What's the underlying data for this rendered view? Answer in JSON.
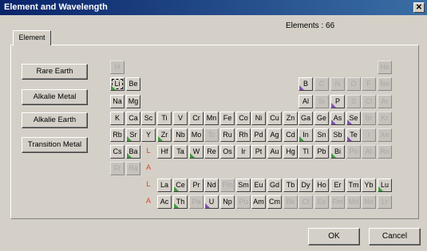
{
  "window": {
    "title": "Element and Wavelength",
    "close_glyph": "✕"
  },
  "count_label": "Elements : 66",
  "tab_label": "Element",
  "side_buttons": [
    "Rare Earth",
    "Alkalie Metal",
    "Alkalie Earth",
    "Transition Metal"
  ],
  "ok_label": "OK",
  "cancel_label": "Cancel",
  "colors": {
    "green_marker": "#3c9a3c",
    "purple_marker": "#8050b0",
    "row_marker": "#e0401a"
  },
  "cells": [
    {
      "r": 0,
      "c": 0,
      "s": "H",
      "st": "off"
    },
    {
      "r": 0,
      "c": 17,
      "s": "He",
      "st": "off"
    },
    {
      "r": 1,
      "c": 0,
      "s": "Li",
      "st": "on",
      "sel": true,
      "m": "g"
    },
    {
      "r": 1,
      "c": 1,
      "s": "Be",
      "st": "on"
    },
    {
      "r": 1,
      "c": 12,
      "s": "B",
      "st": "on",
      "m": "p"
    },
    {
      "r": 1,
      "c": 13,
      "s": "C",
      "st": "off"
    },
    {
      "r": 1,
      "c": 14,
      "s": "N",
      "st": "off"
    },
    {
      "r": 1,
      "c": 15,
      "s": "O",
      "st": "off"
    },
    {
      "r": 1,
      "c": 16,
      "s": "F",
      "st": "off"
    },
    {
      "r": 1,
      "c": 17,
      "s": "Ne",
      "st": "off"
    },
    {
      "r": 2,
      "c": 0,
      "s": "Na",
      "st": "on"
    },
    {
      "r": 2,
      "c": 1,
      "s": "Mg",
      "st": "on"
    },
    {
      "r": 2,
      "c": 12,
      "s": "Al",
      "st": "on"
    },
    {
      "r": 2,
      "c": 13,
      "s": "Si",
      "st": "off"
    },
    {
      "r": 2,
      "c": 14,
      "s": "P",
      "st": "on",
      "m": "p"
    },
    {
      "r": 2,
      "c": 15,
      "s": "S",
      "st": "off"
    },
    {
      "r": 2,
      "c": 16,
      "s": "Cl",
      "st": "off"
    },
    {
      "r": 2,
      "c": 17,
      "s": "Ar",
      "st": "off"
    },
    {
      "r": 3,
      "c": 0,
      "s": "K",
      "st": "on"
    },
    {
      "r": 3,
      "c": 1,
      "s": "Ca",
      "st": "on"
    },
    {
      "r": 3,
      "c": 2,
      "s": "Sc",
      "st": "on"
    },
    {
      "r": 3,
      "c": 3,
      "s": "Ti",
      "st": "on"
    },
    {
      "r": 3,
      "c": 4,
      "s": "V",
      "st": "on"
    },
    {
      "r": 3,
      "c": 5,
      "s": "Cr",
      "st": "on"
    },
    {
      "r": 3,
      "c": 6,
      "s": "Mn",
      "st": "on"
    },
    {
      "r": 3,
      "c": 7,
      "s": "Fe",
      "st": "on"
    },
    {
      "r": 3,
      "c": 8,
      "s": "Co",
      "st": "on"
    },
    {
      "r": 3,
      "c": 9,
      "s": "Ni",
      "st": "on"
    },
    {
      "r": 3,
      "c": 10,
      "s": "Cu",
      "st": "on"
    },
    {
      "r": 3,
      "c": 11,
      "s": "Zn",
      "st": "on"
    },
    {
      "r": 3,
      "c": 12,
      "s": "Ga",
      "st": "on"
    },
    {
      "r": 3,
      "c": 13,
      "s": "Ge",
      "st": "on"
    },
    {
      "r": 3,
      "c": 14,
      "s": "As",
      "st": "on",
      "m": "p"
    },
    {
      "r": 3,
      "c": 15,
      "s": "Se",
      "st": "on",
      "m": "p"
    },
    {
      "r": 3,
      "c": 16,
      "s": "Br",
      "st": "off"
    },
    {
      "r": 3,
      "c": 17,
      "s": "Kr",
      "st": "off"
    },
    {
      "r": 4,
      "c": 0,
      "s": "Rb",
      "st": "on"
    },
    {
      "r": 4,
      "c": 1,
      "s": "Sr",
      "st": "on",
      "m": "g"
    },
    {
      "r": 4,
      "c": 2,
      "s": "Y",
      "st": "on"
    },
    {
      "r": 4,
      "c": 3,
      "s": "Zr",
      "st": "on",
      "m": "g"
    },
    {
      "r": 4,
      "c": 4,
      "s": "Nb",
      "st": "on"
    },
    {
      "r": 4,
      "c": 5,
      "s": "Mo",
      "st": "on"
    },
    {
      "r": 4,
      "c": 6,
      "s": "Tc",
      "st": "off"
    },
    {
      "r": 4,
      "c": 7,
      "s": "Ru",
      "st": "on"
    },
    {
      "r": 4,
      "c": 8,
      "s": "Rh",
      "st": "on"
    },
    {
      "r": 4,
      "c": 9,
      "s": "Pd",
      "st": "on"
    },
    {
      "r": 4,
      "c": 10,
      "s": "Ag",
      "st": "on"
    },
    {
      "r": 4,
      "c": 11,
      "s": "Cd",
      "st": "on"
    },
    {
      "r": 4,
      "c": 12,
      "s": "In",
      "st": "on",
      "m": "g"
    },
    {
      "r": 4,
      "c": 13,
      "s": "Sn",
      "st": "on"
    },
    {
      "r": 4,
      "c": 14,
      "s": "Sb",
      "st": "on"
    },
    {
      "r": 4,
      "c": 15,
      "s": "Te",
      "st": "on",
      "m": "p"
    },
    {
      "r": 4,
      "c": 16,
      "s": "I",
      "st": "off"
    },
    {
      "r": 4,
      "c": 17,
      "s": "Xe",
      "st": "off"
    },
    {
      "r": 5,
      "c": 0,
      "s": "Cs",
      "st": "on"
    },
    {
      "r": 5,
      "c": 1,
      "s": "Ba",
      "st": "on",
      "m": "g"
    },
    {
      "r": 5,
      "c": 2,
      "s": "L",
      "st": "mark"
    },
    {
      "r": 5,
      "c": 3,
      "s": "Hf",
      "st": "on"
    },
    {
      "r": 5,
      "c": 4,
      "s": "Ta",
      "st": "on"
    },
    {
      "r": 5,
      "c": 5,
      "s": "W",
      "st": "on",
      "m": "g"
    },
    {
      "r": 5,
      "c": 6,
      "s": "Re",
      "st": "on"
    },
    {
      "r": 5,
      "c": 7,
      "s": "Os",
      "st": "on"
    },
    {
      "r": 5,
      "c": 8,
      "s": "Ir",
      "st": "on"
    },
    {
      "r": 5,
      "c": 9,
      "s": "Pt",
      "st": "on"
    },
    {
      "r": 5,
      "c": 10,
      "s": "Au",
      "st": "on"
    },
    {
      "r": 5,
      "c": 11,
      "s": "Hg",
      "st": "on"
    },
    {
      "r": 5,
      "c": 12,
      "s": "Tl",
      "st": "on"
    },
    {
      "r": 5,
      "c": 13,
      "s": "Pb",
      "st": "on"
    },
    {
      "r": 5,
      "c": 14,
      "s": "Bi",
      "st": "on",
      "m": "g"
    },
    {
      "r": 5,
      "c": 15,
      "s": "Po",
      "st": "off"
    },
    {
      "r": 5,
      "c": 16,
      "s": "At",
      "st": "off"
    },
    {
      "r": 5,
      "c": 17,
      "s": "Rn",
      "st": "off"
    },
    {
      "r": 6,
      "c": 0,
      "s": "Fr",
      "st": "off"
    },
    {
      "r": 6,
      "c": 1,
      "s": "Ra",
      "st": "off"
    },
    {
      "r": 6,
      "c": 2,
      "s": "A",
      "st": "mark"
    },
    {
      "r": 7,
      "c": 2,
      "s": "L",
      "st": "mark"
    },
    {
      "r": 7,
      "c": 3,
      "s": "La",
      "st": "on"
    },
    {
      "r": 7,
      "c": 4,
      "s": "Ce",
      "st": "on",
      "m": "g"
    },
    {
      "r": 7,
      "c": 5,
      "s": "Pr",
      "st": "on"
    },
    {
      "r": 7,
      "c": 6,
      "s": "Nd",
      "st": "on"
    },
    {
      "r": 7,
      "c": 7,
      "s": "Pm",
      "st": "off"
    },
    {
      "r": 7,
      "c": 8,
      "s": "Sm",
      "st": "on"
    },
    {
      "r": 7,
      "c": 9,
      "s": "Eu",
      "st": "on"
    },
    {
      "r": 7,
      "c": 10,
      "s": "Gd",
      "st": "on"
    },
    {
      "r": 7,
      "c": 11,
      "s": "Tb",
      "st": "on"
    },
    {
      "r": 7,
      "c": 12,
      "s": "Dy",
      "st": "on"
    },
    {
      "r": 7,
      "c": 13,
      "s": "Ho",
      "st": "on"
    },
    {
      "r": 7,
      "c": 14,
      "s": "Er",
      "st": "on"
    },
    {
      "r": 7,
      "c": 15,
      "s": "Tm",
      "st": "on"
    },
    {
      "r": 7,
      "c": 16,
      "s": "Yb",
      "st": "on"
    },
    {
      "r": 7,
      "c": 17,
      "s": "Lu",
      "st": "on",
      "m": "g"
    },
    {
      "r": 8,
      "c": 2,
      "s": "A",
      "st": "mark"
    },
    {
      "r": 8,
      "c": 3,
      "s": "Ac",
      "st": "on"
    },
    {
      "r": 8,
      "c": 4,
      "s": "Th",
      "st": "on",
      "m": "g"
    },
    {
      "r": 8,
      "c": 5,
      "s": "Pa",
      "st": "off"
    },
    {
      "r": 8,
      "c": 6,
      "s": "U",
      "st": "on",
      "m": "p"
    },
    {
      "r": 8,
      "c": 7,
      "s": "Np",
      "st": "on"
    },
    {
      "r": 8,
      "c": 8,
      "s": "Pu",
      "st": "off"
    },
    {
      "r": 8,
      "c": 9,
      "s": "Am",
      "st": "on"
    },
    {
      "r": 8,
      "c": 10,
      "s": "Cm",
      "st": "on"
    },
    {
      "r": 8,
      "c": 11,
      "s": "Bk",
      "st": "off"
    },
    {
      "r": 8,
      "c": 12,
      "s": "Cf",
      "st": "off"
    },
    {
      "r": 8,
      "c": 13,
      "s": "Es",
      "st": "off"
    },
    {
      "r": 8,
      "c": 14,
      "s": "Fm",
      "st": "off"
    },
    {
      "r": 8,
      "c": 15,
      "s": "Md",
      "st": "off"
    },
    {
      "r": 8,
      "c": 16,
      "s": "No",
      "st": "off"
    },
    {
      "r": 8,
      "c": 17,
      "s": "Lr",
      "st": "off"
    }
  ]
}
